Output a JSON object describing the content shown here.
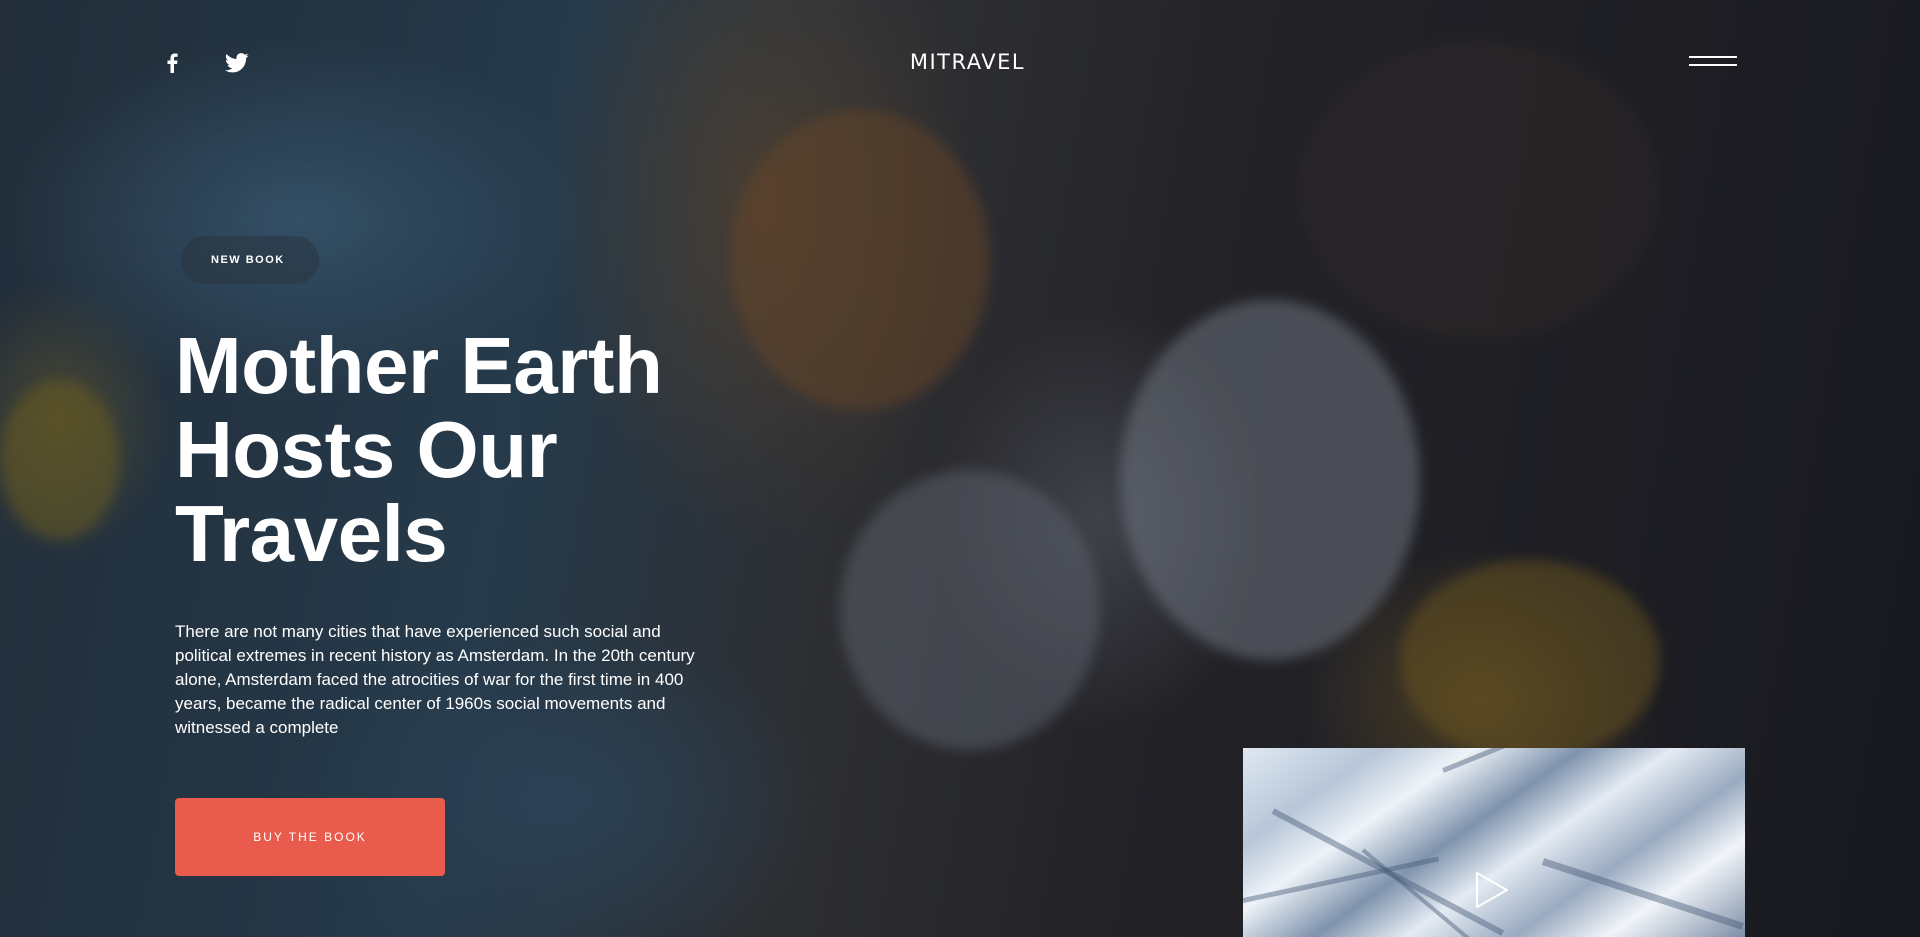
{
  "header": {
    "brand": "MITRAVEL",
    "social": [
      {
        "icon": "facebook-icon"
      },
      {
        "icon": "twitter-icon"
      }
    ],
    "menu_icon": "hamburger-menu-icon"
  },
  "hero": {
    "badge": "NEW BOOK",
    "headline_lines": [
      "Mother Earth",
      "Hosts Our",
      "Travels"
    ],
    "description": "There are not many cities that have experienced such social and political extremes in recent history as Amsterdam. In the 20th century alone, Amsterdam faced the atrocities of war for the first time in 400 years, became the radical center of 1960s social movements and witnessed a complete",
    "cta_label": "BUY THE BOOK"
  },
  "video": {
    "play_icon": "play-icon"
  },
  "colors": {
    "accent": "#e95b4c",
    "text": "#ffffff"
  }
}
